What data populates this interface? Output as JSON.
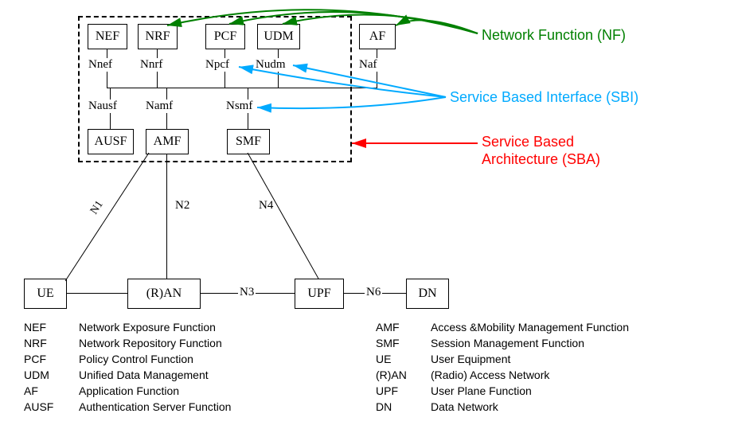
{
  "nodes": {
    "nef": "NEF",
    "nrf": "NRF",
    "pcf": "PCF",
    "udm": "UDM",
    "af": "AF",
    "ausf": "AUSF",
    "amf": "AMF",
    "smf": "SMF",
    "ue": "UE",
    "ran": "(R)AN",
    "upf": "UPF",
    "dn": "DN"
  },
  "interfaces": {
    "nnef": "Nnef",
    "nnrf": "Nnrf",
    "npcf": "Npcf",
    "nudm": "Nudm",
    "naf": "Naf",
    "nausf": "Nausf",
    "namf": "Namf",
    "nsmf": "Nsmf"
  },
  "refpoints": {
    "n1": "N1",
    "n2": "N2",
    "n3": "N3",
    "n4": "N4",
    "n6": "N6"
  },
  "annotations": {
    "nf": "Network Function (NF)",
    "sbi": "Service Based Interface (SBI)",
    "sba1": "Service Based",
    "sba2": "Architecture (SBA)"
  },
  "legend_left": [
    [
      "NEF",
      "Network Exposure Function"
    ],
    [
      "NRF",
      "Network Repository Function"
    ],
    [
      "PCF",
      "Policy Control Function"
    ],
    [
      "UDM",
      "Unified Data Management"
    ],
    [
      "AF",
      "Application Function"
    ],
    [
      "AUSF",
      "Authentication Server Function"
    ]
  ],
  "legend_right": [
    [
      "AMF",
      "Access &Mobility Management Function"
    ],
    [
      "SMF",
      "Session Management Function"
    ],
    [
      "UE",
      "User Equipment"
    ],
    [
      "(R)AN",
      "(Radio) Access Network"
    ],
    [
      "UPF",
      "User Plane Function"
    ],
    [
      "DN",
      "Data Network"
    ]
  ]
}
